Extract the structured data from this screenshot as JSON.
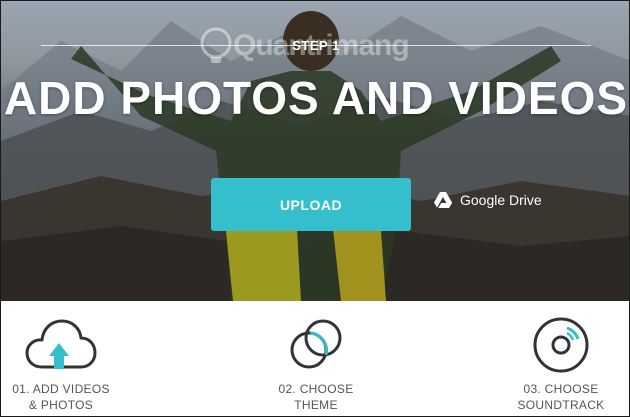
{
  "hero": {
    "step_label": "STEP 1",
    "title": "ADD PHOTOS AND VIDEOS",
    "watermark": "Quantrimang",
    "upload_button": "UPLOAD",
    "google_drive_label": "Google Drive"
  },
  "steps": [
    {
      "line1": "01. ADD VIDEOS",
      "line2": "& PHOTOS",
      "icon": "cloud-upload-icon",
      "active": true
    },
    {
      "line1": "02. CHOOSE",
      "line2": "THEME",
      "icon": "theme-circles-icon",
      "active": false
    },
    {
      "line1": "03. CHOOSE",
      "line2": "SOUNDTRACK",
      "icon": "soundtrack-disc-icon",
      "active": false
    }
  ],
  "colors": {
    "accent": "#35bfcc",
    "icon_stroke": "#333333",
    "step_text": "#555555"
  }
}
